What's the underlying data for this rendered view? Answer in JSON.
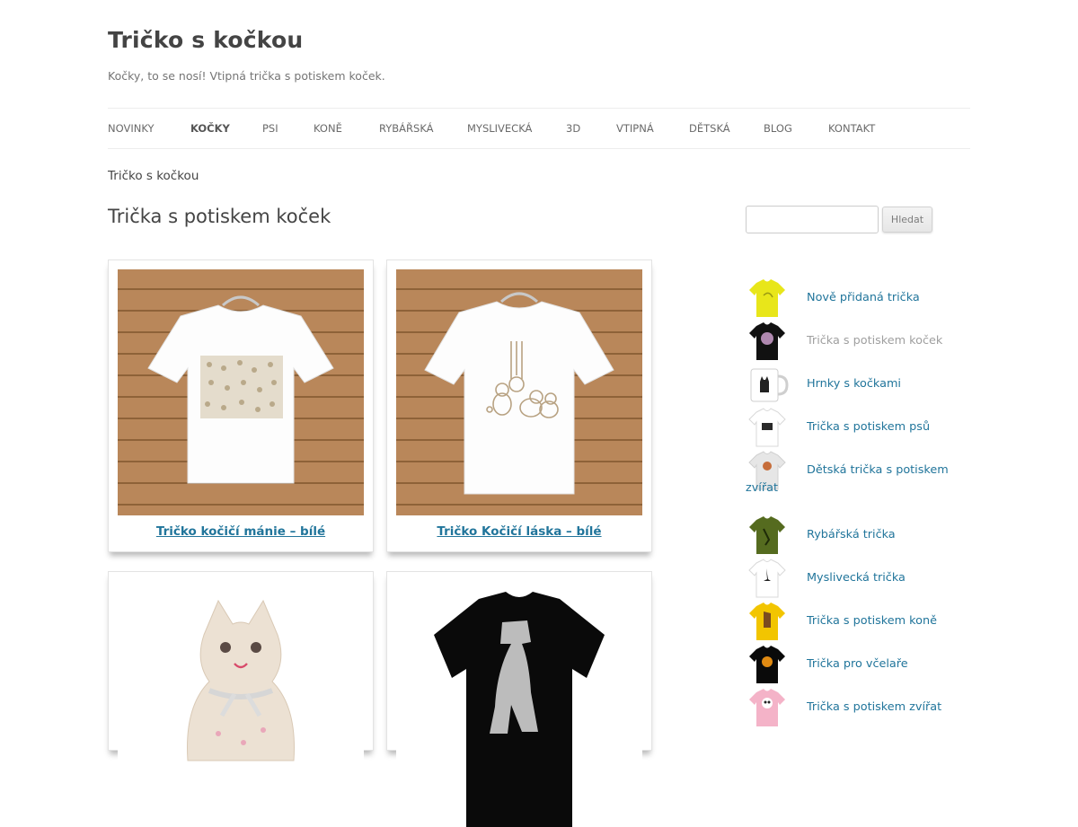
{
  "site": {
    "title": "Tričko s kočkou",
    "description": "Kočky, to se nosí! Vtipná trička s potiskem koček."
  },
  "nav": {
    "items": [
      {
        "label": "Novinky"
      },
      {
        "label": "Kočky",
        "active": true
      },
      {
        "label": "Psi"
      },
      {
        "label": "Koně"
      },
      {
        "label": "Rybářská"
      },
      {
        "label": "Myslivecká"
      },
      {
        "label": "3D"
      },
      {
        "label": "Vtipná"
      },
      {
        "label": "Dětská"
      },
      {
        "label": "Blog"
      },
      {
        "label": "Kontakt"
      }
    ]
  },
  "breadcrumb": "Tričko s kočkou",
  "page_title": "Trička s potiskem koček",
  "products": [
    {
      "title": "Tričko kočičí mánie – bílé"
    },
    {
      "title": "Tričko Kočičí láska – bílé"
    },
    {
      "title": ""
    },
    {
      "title": ""
    }
  ],
  "search": {
    "placeholder": "",
    "button": "Hledat"
  },
  "categories": [
    {
      "label": "Nově přidaná trička",
      "icon": "yellow-tshirt-icon",
      "color": "#e8e61a"
    },
    {
      "label": "Trička s potiskem koček",
      "icon": "black-tshirt-icon",
      "color": "#111111",
      "current": true
    },
    {
      "label": "Hrnky s kočkami",
      "icon": "mug-icon",
      "color": "#ffffff"
    },
    {
      "label": "Trička s potiskem psů",
      "icon": "white-tshirt-icon",
      "color": "#ffffff"
    },
    {
      "label": "Dětská trička s potiskem",
      "label2": "zvířat",
      "icon": "grey-tshirt-icon",
      "color": "#e6e6e6"
    },
    {
      "label": "Rybářská trička",
      "icon": "olive-tshirt-icon",
      "color": "#556b1f"
    },
    {
      "label": "Myslivecká trička",
      "icon": "white-tshirt-icon",
      "color": "#ffffff"
    },
    {
      "label": "Trička s potiskem koně",
      "icon": "yellow-tshirt-icon",
      "color": "#f2c500"
    },
    {
      "label": "Trička pro včelaře",
      "icon": "black-tshirt-icon",
      "color": "#0a0a0a"
    },
    {
      "label": "Trička s potiskem zvířat",
      "icon": "pink-tshirt-icon",
      "color": "#f4b3c8"
    }
  ]
}
